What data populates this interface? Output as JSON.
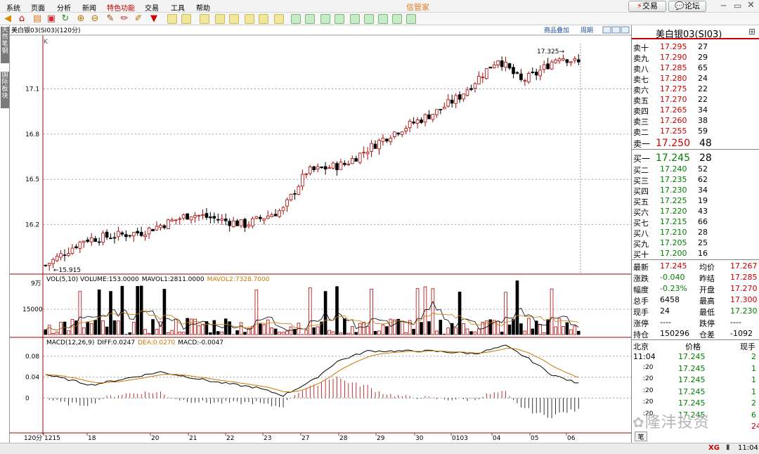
{
  "menu": {
    "items": [
      "系统",
      "页面",
      "分析",
      "新闻",
      "特色功能",
      "交易",
      "工具",
      "帮助"
    ],
    "title": "信管家"
  },
  "topbuttons": {
    "trade": "交易",
    "forum": "论坛"
  },
  "leftTabs": {
    "tab1": "天然笔钢",
    "tab2": "国际板块"
  },
  "chart": {
    "header": "美白银03(SI03)(120分)",
    "links": {
      "overlay": "商品叠加",
      "period": "周期"
    },
    "kLabel": "K",
    "price_ticks": [
      "17.1",
      "16.8",
      "16.5",
      "16.2"
    ],
    "high_label": "17.325",
    "low_label": "15.915",
    "vol_header": {
      "base": "VOL(5,10) VOLUME:153.0000",
      "mavol1": "MAVOL1:2811.0000",
      "mavol2": "MAVOL2:7328.7000"
    },
    "vol_ticks": [
      "9万",
      "15000"
    ],
    "macd_header": {
      "base": "MACD(12,26,9)",
      "diff": "DIFF:0.0247",
      "dea": "DEA:0.0270",
      "macd": "MACD:-0.0047"
    },
    "macd_ticks": [
      "0.08",
      "0.04",
      "0"
    ],
    "period_label": "120分",
    "date_labels": [
      "1215",
      "18",
      "20",
      "21",
      "22",
      "23",
      "27",
      "28",
      "29",
      "30",
      "0103",
      "04",
      "05",
      "06"
    ]
  },
  "chart_data": {
    "type": "candlestick",
    "ylim": [
      15.9,
      17.4
    ],
    "ohlc": [],
    "volume": [],
    "macd": []
  },
  "quote": {
    "title": "美白银03(SI03)",
    "asks": [
      {
        "label": "卖十",
        "price": "17.295",
        "vol": "27"
      },
      {
        "label": "卖九",
        "price": "17.290",
        "vol": "29"
      },
      {
        "label": "卖八",
        "price": "17.285",
        "vol": "65"
      },
      {
        "label": "卖七",
        "price": "17.280",
        "vol": "24"
      },
      {
        "label": "卖六",
        "price": "17.275",
        "vol": "22"
      },
      {
        "label": "卖五",
        "price": "17.270",
        "vol": "22"
      },
      {
        "label": "卖四",
        "price": "17.265",
        "vol": "34"
      },
      {
        "label": "卖三",
        "price": "17.260",
        "vol": "38"
      },
      {
        "label": "卖二",
        "price": "17.255",
        "vol": "59"
      },
      {
        "label": "卖一",
        "price": "17.250",
        "vol": "48"
      }
    ],
    "bids": [
      {
        "label": "买一",
        "price": "17.245",
        "vol": "28"
      },
      {
        "label": "买二",
        "price": "17.240",
        "vol": "52"
      },
      {
        "label": "买三",
        "price": "17.235",
        "vol": "62"
      },
      {
        "label": "买四",
        "price": "17.230",
        "vol": "34"
      },
      {
        "label": "买五",
        "price": "17.225",
        "vol": "19"
      },
      {
        "label": "买六",
        "price": "17.220",
        "vol": "43"
      },
      {
        "label": "买七",
        "price": "17.215",
        "vol": "66"
      },
      {
        "label": "买八",
        "price": "17.210",
        "vol": "28"
      },
      {
        "label": "买九",
        "price": "17.205",
        "vol": "25"
      },
      {
        "label": "买十",
        "price": "17.200",
        "vol": "16"
      }
    ],
    "stats": [
      {
        "l1": "最新",
        "v1": "17.245",
        "l2": "均价",
        "v2": "17.267"
      },
      {
        "l1": "涨跌",
        "v1": "-0.040",
        "l2": "昨结",
        "v2": "17.285"
      },
      {
        "l1": "幅度",
        "v1": "-0.23%",
        "l2": "开盘",
        "v2": "17.270"
      },
      {
        "l1": "总手",
        "v1": "6458",
        "l2": "最高",
        "v2": "17.300"
      },
      {
        "l1": "现手",
        "v1": "24",
        "l2": "最低",
        "v2": "17.230"
      },
      {
        "l1": "涨停",
        "v1": "----",
        "l2": "跌停",
        "v2": "----"
      },
      {
        "l1": "持仓",
        "v1": "150296",
        "l2": "仓差",
        "v2": "-1092"
      }
    ],
    "ticks_header": {
      "loc": "北京",
      "price": "价格",
      "qty": "现手"
    },
    "ticks": [
      {
        "time": "11:04",
        "price": "17.245",
        "qty": "2"
      },
      {
        "time": ":20",
        "price": "17.245",
        "qty": "1"
      },
      {
        "time": ":20",
        "price": "17.245",
        "qty": "1"
      },
      {
        "time": ":20",
        "price": "17.245",
        "qty": "1"
      },
      {
        "time": ":20",
        "price": "17.245",
        "qty": "2"
      },
      {
        "time": ":20",
        "price": "17.245",
        "qty": "6"
      },
      {
        "time": "",
        "price": "",
        "qty": "24"
      }
    ],
    "bottom_tab": "笔"
  },
  "watermark": "隆沣投资",
  "status": {
    "time": "11:04",
    "logo": "XG"
  }
}
